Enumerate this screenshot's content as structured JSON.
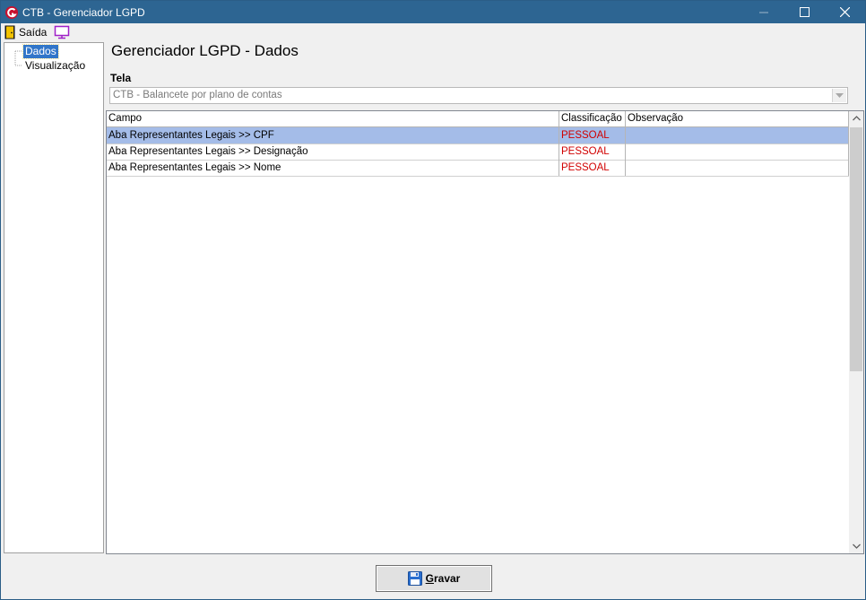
{
  "window": {
    "title": "CTB - Gerenciador LGPD"
  },
  "menu": {
    "exit_label": "Saída",
    "exit_icon": "door-exit-icon",
    "screen_icon": "monitor-icon"
  },
  "tree": {
    "items": [
      {
        "label": "Dados",
        "selected": true
      },
      {
        "label": "Visualização",
        "selected": false
      }
    ]
  },
  "main": {
    "heading": "Gerenciador LGPD - Dados",
    "tela_label": "Tela",
    "tela_value": "CTB - Balancete por plano de contas"
  },
  "grid": {
    "columns": [
      "Campo",
      "Classificação",
      "Observação"
    ],
    "rows": [
      {
        "campo": "Aba Representantes Legais >> CPF",
        "classificacao": "PESSOAL",
        "observacao": "",
        "selected": true
      },
      {
        "campo": "Aba Representantes Legais >> Designação",
        "classificacao": "PESSOAL",
        "observacao": "",
        "selected": false
      },
      {
        "campo": "Aba Representantes Legais >> Nome",
        "classificacao": "PESSOAL",
        "observacao": "",
        "selected": false
      }
    ]
  },
  "footer": {
    "save_label_first": "G",
    "save_label_rest": "ravar",
    "save_icon": "floppy-disk-icon"
  },
  "colors": {
    "titlebar": "#2d6592",
    "selection": "#a4bce8",
    "classification_text": "#d10000"
  }
}
